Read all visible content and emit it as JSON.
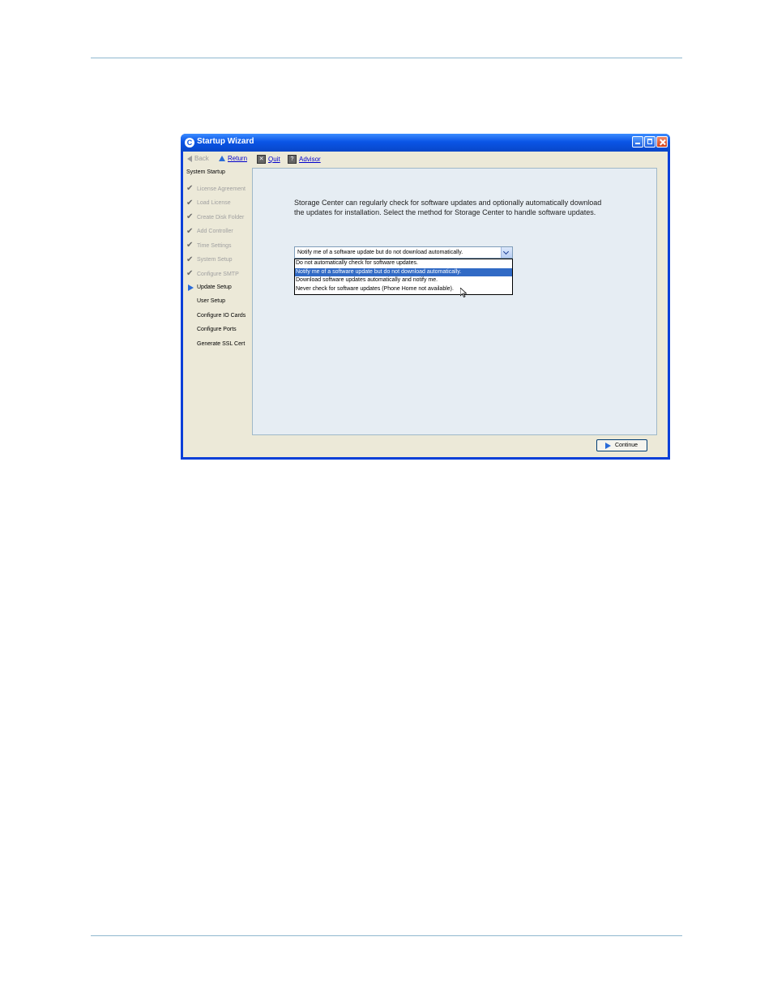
{
  "window": {
    "title": "Startup Wizard",
    "app_icon": "C",
    "accent": "#0a55e6"
  },
  "toolbar": {
    "back_label": "Back",
    "return_label": "Return",
    "quit_label": "Quit",
    "advisor_label": "Advisor",
    "advisor_icon_glyph": "?"
  },
  "sidebar": {
    "heading": "System Startup",
    "items": [
      {
        "label": "License Agreement",
        "state": "done"
      },
      {
        "label": "Load License",
        "state": "done"
      },
      {
        "label": "Create Disk Folder",
        "state": "done"
      },
      {
        "label": "Add Controller",
        "state": "done"
      },
      {
        "label": "Time Settings",
        "state": "done"
      },
      {
        "label": "System Setup",
        "state": "done"
      },
      {
        "label": "Configure SMTP",
        "state": "done"
      },
      {
        "label": "Update Setup",
        "state": "current"
      },
      {
        "label": "User Setup",
        "state": "todo"
      },
      {
        "label": "Configure IO Cards",
        "state": "todo"
      },
      {
        "label": "Configure Ports",
        "state": "todo"
      },
      {
        "label": "Generate SSL Cert",
        "state": "todo"
      }
    ]
  },
  "main": {
    "description": "Storage Center can regularly check for software updates and optionally automatically download the updates for installation. Select the method for Storage Center to handle software updates.",
    "combo_value": "Notify me of a software update but do not download automatically.",
    "options": [
      "Do not automatically check for software updates.",
      "Notify me of a software update but do not download automatically.",
      "Download software updates automatically and notify me.",
      "Never check for software updates (Phone Home not available)."
    ],
    "selected_option_index": 1
  },
  "footer": {
    "continue_label": "Continue"
  }
}
